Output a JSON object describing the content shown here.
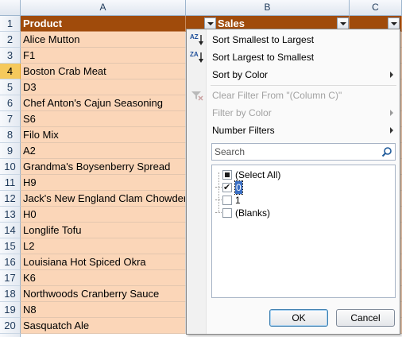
{
  "columns": [
    "A",
    "B",
    "C"
  ],
  "header_row": {
    "row_num": "1",
    "product": "Product",
    "sales": "Sales"
  },
  "rows": [
    {
      "num": "2",
      "product": "Alice Mutton"
    },
    {
      "num": "3",
      "product": "F1"
    },
    {
      "num": "4",
      "product": "Boston Crab Meat"
    },
    {
      "num": "5",
      "product": "D3"
    },
    {
      "num": "6",
      "product": "Chef Anton's Cajun Seasoning"
    },
    {
      "num": "7",
      "product": "S6"
    },
    {
      "num": "8",
      "product": "Filo Mix"
    },
    {
      "num": "9",
      "product": "A2"
    },
    {
      "num": "10",
      "product": "Grandma's Boysenberry Spread"
    },
    {
      "num": "11",
      "product": "H9"
    },
    {
      "num": "12",
      "product": "Jack's New England Clam Chowder"
    },
    {
      "num": "13",
      "product": "H0"
    },
    {
      "num": "14",
      "product": "Longlife Tofu"
    },
    {
      "num": "15",
      "product": "L2"
    },
    {
      "num": "16",
      "product": "Louisiana Hot Spiced Okra"
    },
    {
      "num": "17",
      "product": "K6"
    },
    {
      "num": "18",
      "product": "Northwoods Cranberry Sauce"
    },
    {
      "num": "19",
      "product": "N8"
    },
    {
      "num": "20",
      "product": "Sasquatch Ale"
    }
  ],
  "menu": {
    "sort_asc": "Sort Smallest to Largest",
    "sort_desc": "Sort Largest to Smallest",
    "sort_color": "Sort by Color",
    "clear_filter": "Clear Filter From \"(Column C)\"",
    "filter_color": "Filter by Color",
    "number_filters": "Number Filters",
    "search_placeholder": "Search",
    "sort_asc_icon": "AZ",
    "sort_desc_icon": "ZA",
    "items": [
      "(Select All)",
      "0",
      "1",
      "(Blanks)"
    ],
    "ok": "OK",
    "cancel": "Cancel"
  },
  "colors": {
    "header_bg": "#a04b0b",
    "cell_bg": "#fbd6b8",
    "active_row": "#f5c95c"
  }
}
